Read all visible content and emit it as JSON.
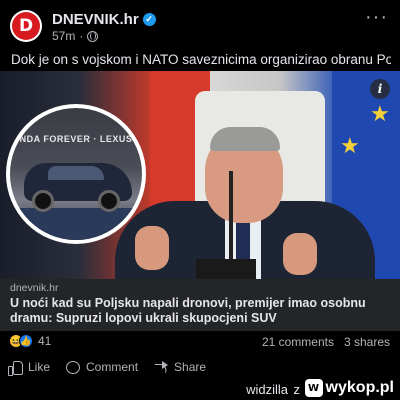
{
  "post": {
    "page_name": "DNEVNIK.hr",
    "avatar_letter": "D",
    "time": "57m",
    "time_sep": "·",
    "more_label": "···",
    "caption": "Dok je on s vojskom i NATO saveznicima organizirao obranu Poljske..."
  },
  "media": {
    "inset_text": "NDA FOREVER · LEXUS",
    "info_label": "i"
  },
  "link": {
    "domain": "dnevnik.hr",
    "title": "U noći kad su Poljsku napali dronovi, premijer imao osobnu dramu: Supruzi lopovi ukrali skupocjeni SUV"
  },
  "stats": {
    "reaction_count": "41",
    "comments": "21 comments",
    "shares": "3 shares"
  },
  "actions": {
    "like": "Like",
    "comment": "Comment",
    "share": "Share"
  },
  "footer": {
    "username": "widzilla",
    "separator": "z",
    "site": "wykop.pl",
    "site_mark": "W"
  },
  "colors": {
    "verified": "#1d9bf0",
    "avatar_bg": "#d71920",
    "like_reaction": "#1877f2",
    "haha_reaction": "#f7c33a"
  },
  "icons": [
    "verified-badge-icon",
    "globe-icon",
    "more-icon",
    "info-icon",
    "haha-reaction-icon",
    "like-reaction-icon",
    "like-icon",
    "comment-icon",
    "share-icon",
    "wykop-logo-icon"
  ]
}
